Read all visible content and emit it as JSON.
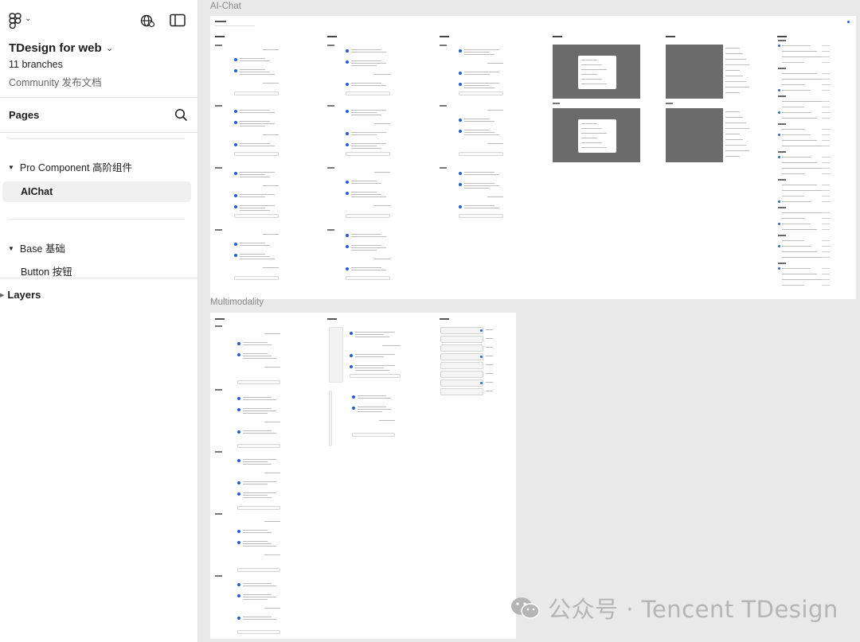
{
  "header": {
    "file_title": "TDesign for web",
    "branches": "11 branches",
    "community": "Community 发布文档"
  },
  "pages": {
    "label": "Pages",
    "groups": [
      {
        "label": "Pro Component 高阶组件",
        "items": [
          "AIChat"
        ]
      },
      {
        "label": "Base 基础",
        "items": [
          "Button 按钮"
        ]
      }
    ],
    "active": "AIChat"
  },
  "layers": {
    "label": "Layers"
  },
  "canvas": {
    "frames": [
      {
        "label": "AI-Chat"
      },
      {
        "label": "Multimodality"
      }
    ]
  },
  "watermark": {
    "text": "公众号 · Tencent TDesign"
  },
  "colors": {
    "accent": "#1f5fd6",
    "sidebar_bg": "#ffffff",
    "canvas_bg": "#e9e9e9",
    "panel_gray": "#6b6b6b"
  },
  "icons": [
    "figma-logo-icon",
    "chevron-down-icon",
    "globe-icon",
    "sidebar-toggle-icon",
    "search-icon",
    "triangle-down-icon",
    "triangle-right-icon",
    "wechat-icon"
  ]
}
